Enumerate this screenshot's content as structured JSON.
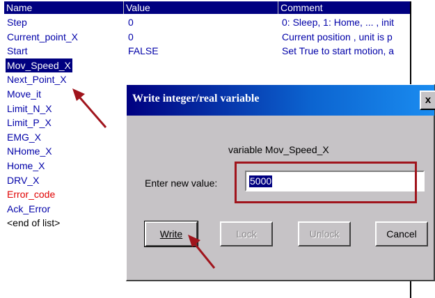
{
  "table": {
    "headers": {
      "name": "Name",
      "value": "Value",
      "comment": "Comment"
    },
    "rows": [
      {
        "name": "Step",
        "value": "0",
        "comment": "0: Sleep, 1: Home, ... , init"
      },
      {
        "name": "Current_point_X",
        "value": "0",
        "comment": "Current position , unit is p"
      },
      {
        "name": "Start",
        "value": "FALSE",
        "comment": "Set True to start motion, a"
      },
      {
        "name": "Mov_Speed_X",
        "value": "",
        "comment": ""
      },
      {
        "name": "Next_Point_X",
        "value": "",
        "comment": ""
      },
      {
        "name": "Move_it",
        "value": "",
        "comment": ""
      },
      {
        "name": "Limit_N_X",
        "value": "",
        "comment": ""
      },
      {
        "name": "Limit_P_X",
        "value": "",
        "comment": ""
      },
      {
        "name": "EMG_X",
        "value": "",
        "comment": ""
      },
      {
        "name": "NHome_X",
        "value": "",
        "comment": ""
      },
      {
        "name": "Home_X",
        "value": "",
        "comment": ""
      },
      {
        "name": "DRV_X",
        "value": "",
        "comment": ""
      },
      {
        "name": "Error_code",
        "value": "",
        "comment": ""
      },
      {
        "name": "Ack_Error",
        "value": "",
        "comment": ""
      },
      {
        "name": "<end of list>",
        "value": "",
        "comment": ""
      }
    ]
  },
  "dialog": {
    "title": "Write integer/real variable",
    "close_label": "x",
    "variable_label": "variable Mov_Speed_X",
    "enter_label": "Enter new value:",
    "input_value": "5000",
    "buttons": {
      "write": "Write",
      "lock": "Lock",
      "unlock": "Unlock",
      "cancel": "Cancel"
    }
  },
  "colors": {
    "header_bg": "#000080",
    "name_text": "#0000a8",
    "error_text": "#e00000",
    "highlight_box": "#a0141c",
    "annotation_arrow": "#a0141c"
  }
}
